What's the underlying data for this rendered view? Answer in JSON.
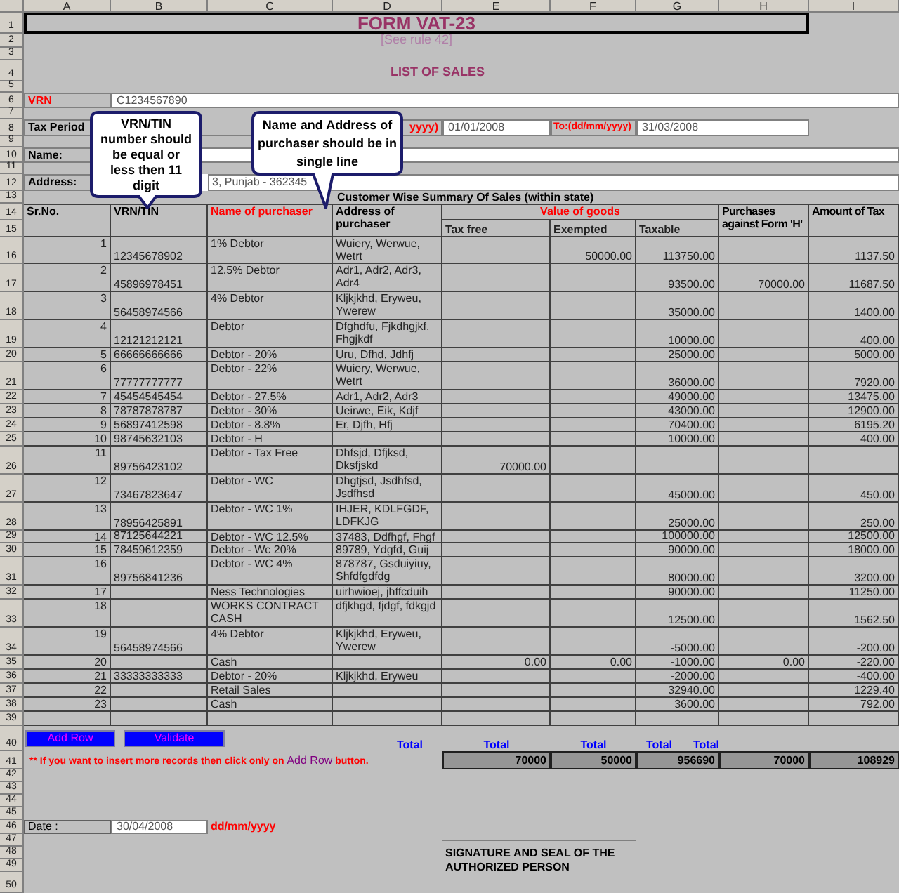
{
  "column_headers": [
    "A",
    "B",
    "C",
    "D",
    "E",
    "F",
    "G",
    "H",
    "I"
  ],
  "row_numbers": [
    "1",
    "2",
    "3",
    "4",
    "5",
    "6",
    "7",
    "8",
    "9",
    "10",
    "11",
    "12",
    "13",
    "14",
    "15",
    "16",
    "17",
    "18",
    "19",
    "20",
    "21",
    "22",
    "23",
    "24",
    "25",
    "26",
    "27",
    "28",
    "29",
    "30",
    "31",
    "32",
    "33",
    "34",
    "35",
    "36",
    "37",
    "38",
    "39",
    "40",
    "41",
    "42",
    "43",
    "44",
    "45",
    "46",
    "47",
    "48",
    "49",
    "50"
  ],
  "title": "FORM VAT-23",
  "subtitle": "[See rule 42]",
  "heading": "LIST OF SALES",
  "vrn": {
    "label": "VRN",
    "value": "C1234567890"
  },
  "tax_period": {
    "label": "Tax Period",
    "from_label": "yyyy)",
    "from_value": "01/01/2008",
    "to_label": "To:(dd/mm/yyyy)",
    "to_value": "31/03/2008"
  },
  "name": {
    "label": "Name:"
  },
  "address": {
    "label": "Address:",
    "value": "3, Punjab - 362345"
  },
  "summary_title": "Customer Wise Summary Of Sales (within state)",
  "table": {
    "columns": [
      {
        "label": "Sr.No.",
        "color": "#000000"
      },
      {
        "label": "VRN/TIN",
        "color": "#000000"
      },
      {
        "label": "Name of purchaser",
        "color": "#ff0000"
      },
      {
        "label": "Address of purchaser",
        "color": "#000000"
      },
      {
        "label": "Value of goods",
        "color": "#ff0000",
        "children": [
          {
            "label": "Tax free"
          },
          {
            "label": "Exempted"
          },
          {
            "label": "Taxable"
          }
        ]
      },
      {
        "label": "Purchases against Form 'H'",
        "color": "#000000"
      },
      {
        "label": "Amount of Tax",
        "color": "#000000"
      }
    ],
    "rows": [
      {
        "sr": "1",
        "vrn": "12345678902",
        "name": "1% Debtor",
        "address": "Wuiery, Werwue, Wetrt",
        "exempted": "50000.00",
        "taxable": "113750.00",
        "tax": "1137.50"
      },
      {
        "sr": "2",
        "vrn": "45896978451",
        "name": "12.5% Debtor",
        "address": "Adr1, Adr2, Adr3, Adr4",
        "taxable": "93500.00",
        "form_h": "70000.00",
        "tax": "11687.50"
      },
      {
        "sr": "3",
        "vrn": "56458974566",
        "name": "4% Debtor",
        "address": "Kljkjkhd, Eryweu, Ywerew",
        "taxable": "35000.00",
        "tax": "1400.00"
      },
      {
        "sr": "4",
        "vrn": "12121212121",
        "name": "Debtor",
        "address": "Dfghdfu, Fjkdhgjkf, Fhgjkdf",
        "taxable": "10000.00",
        "tax": "400.00"
      },
      {
        "sr": "5",
        "vrn": "66666666666",
        "name": "Debtor - 20%",
        "address": "Uru, Dfhd, Jdhfj",
        "taxable": "25000.00",
        "tax": "5000.00"
      },
      {
        "sr": "6",
        "vrn": "77777777777",
        "name": "Debtor - 22%",
        "address": "Wuiery, Werwue, Wetrt",
        "taxable": "36000.00",
        "tax": "7920.00"
      },
      {
        "sr": "7",
        "vrn": "45454545454",
        "name": "Debtor - 27.5%",
        "address": "Adr1, Adr2, Adr3",
        "taxable": "49000.00",
        "tax": "13475.00"
      },
      {
        "sr": "8",
        "vrn": "78787878787",
        "name": "Debtor - 30%",
        "address": "Ueirwe, Eik, Kdjf",
        "taxable": "43000.00",
        "tax": "12900.00"
      },
      {
        "sr": "9",
        "vrn": "56897412598",
        "name": "Debtor - 8.8%",
        "address": "Er, Djfh, Hfj",
        "taxable": "70400.00",
        "tax": "6195.20"
      },
      {
        "sr": "10",
        "vrn": "98745632103",
        "name": "Debtor - H",
        "taxable": "10000.00",
        "tax": "400.00"
      },
      {
        "sr": "11",
        "vrn": "89756423102",
        "name": "Debtor - Tax Free",
        "address": "Dhfsjd, Dfjksd, Dksfjskd",
        "tax_free": "70000.00"
      },
      {
        "sr": "12",
        "vrn": "73467823647",
        "name": "Debtor - WC",
        "address": "Dhgtjsd, Jsdhfsd, Jsdfhsd",
        "taxable": "45000.00",
        "tax": "450.00"
      },
      {
        "sr": "13",
        "vrn": "78956425891",
        "name": "Debtor - WC 1%",
        "address": "IHJER, KDLFGDF, LDFKJG",
        "taxable": "25000.00",
        "tax": "250.00"
      },
      {
        "sr": "14",
        "vrn": "87125644221",
        "name": "Debtor - WC 12.5%",
        "address": "37483, Ddfhgf, Fhgf",
        "taxable": "100000.00",
        "tax": "12500.00"
      },
      {
        "sr": "15",
        "vrn": "78459612359",
        "name": "Debtor - Wc 20%",
        "address": "89789, Ydgfd, Guij",
        "taxable": "90000.00",
        "tax": "18000.00"
      },
      {
        "sr": "16",
        "vrn": "89756841236",
        "name": "Debtor - WC 4%",
        "address": "878787, Gsduiyiuy, Shfdfgdfdg",
        "taxable": "80000.00",
        "tax": "3200.00"
      },
      {
        "sr": "17",
        "name": "Ness Technologies",
        "address": "uirhwioej, jhffcduih",
        "taxable": "90000.00",
        "tax": "11250.00"
      },
      {
        "sr": "18",
        "name": "WORKS CONTRACT CASH",
        "address": "dfjkhgd, fjdgf, fdkgjd",
        "taxable": "12500.00",
        "tax": "1562.50"
      },
      {
        "sr": "19",
        "vrn": "56458974566",
        "name": "4% Debtor",
        "address": "Kljkjkhd, Eryweu, Ywerew",
        "taxable": "-5000.00",
        "tax": "-200.00"
      },
      {
        "sr": "20",
        "name": "Cash",
        "tax_free": "0.00",
        "exempted": "0.00",
        "taxable": "-1000.00",
        "form_h": "0.00",
        "tax": "-220.00"
      },
      {
        "sr": "21",
        "vrn": "33333333333",
        "name": "Debtor - 20%",
        "address": "Kljkjkhd, Eryweu",
        "taxable": "-2000.00",
        "tax": "-400.00"
      },
      {
        "sr": "22",
        "name": "Retail Sales",
        "taxable": "32940.00",
        "tax": "1229.40"
      },
      {
        "sr": "23",
        "name": "Cash",
        "taxable": "3600.00",
        "tax": "792.00"
      }
    ]
  },
  "buttons": [
    {
      "label": "Add Row"
    },
    {
      "label": "Validate"
    }
  ],
  "totals": {
    "labels": [
      "Total",
      "Total",
      "Total",
      "Total",
      "Total"
    ],
    "values": [
      "70000",
      "50000",
      "956690",
      "70000",
      "108929"
    ]
  },
  "note": {
    "text": "** If you want to insert more records then click only on",
    "link": "Add Row",
    "suffix": "button."
  },
  "date": {
    "label": "Date :",
    "value": "30/04/2008",
    "format": "dd/mm/yyyy"
  },
  "signature": "SIGNATURE AND SEAL OF THE AUTHORIZED PERSON",
  "callouts": [
    {
      "text": "VRN/TIN number should be equal or less then 11 digit"
    },
    {
      "text": "Name and Address of purchaser  should be in single line"
    }
  ]
}
